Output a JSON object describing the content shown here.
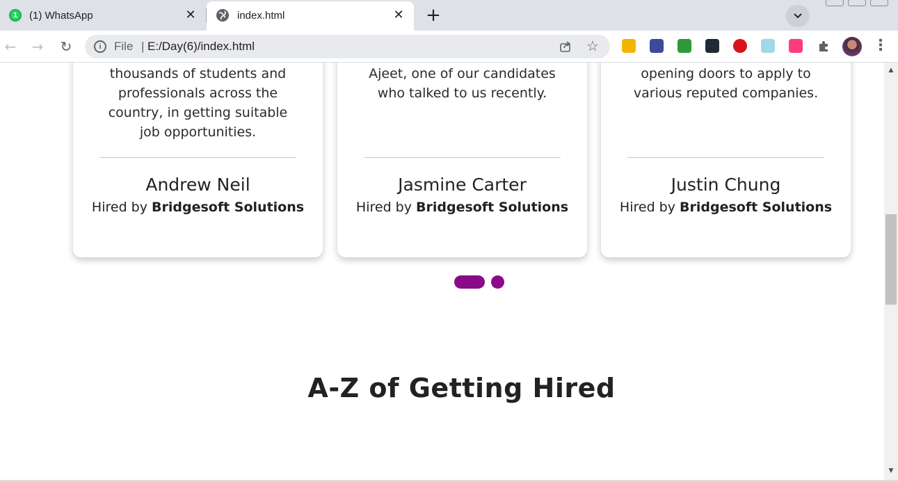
{
  "browser": {
    "tabs": [
      {
        "title": "(1) WhatsApp",
        "favicon": "whatsapp-icon",
        "badge": "1",
        "active": false
      },
      {
        "title": "index.html",
        "favicon": "globe-icon",
        "active": true
      }
    ],
    "close_glyph": "✕",
    "new_tab_glyph": "+",
    "tab_search_glyph": "⌄",
    "nav": {
      "back": "←",
      "forward": "→",
      "reload": "↻"
    },
    "omnibox": {
      "info_glyph": "i",
      "scheme": "File",
      "separator": "|",
      "url": "E:/Day(6)/index.html"
    },
    "star_glyph": "☆",
    "menu_glyph": "⋮",
    "extensions": [
      {
        "name": "ext-folder-icon",
        "color": "#f4b400"
      },
      {
        "name": "ext-screen-icon",
        "color": "#3c4a9e"
      },
      {
        "name": "ext-tomato-icon",
        "color": "#2e9a3a"
      },
      {
        "name": "ext-terminal-icon",
        "color": "#1f2a36"
      },
      {
        "name": "ext-ask-icon",
        "color": "#d7141a"
      },
      {
        "name": "ext-clip-icon",
        "color": "#9fd8e6"
      },
      {
        "name": "ext-music-icon",
        "color": "#ff3b7f"
      },
      {
        "name": "extensions-puzzle-icon",
        "color": "#5f6368"
      }
    ]
  },
  "testimonials": [
    {
      "quote_lines": [
        "thousands of students and",
        "professionals across the",
        "country, in getting suitable",
        "job opportunities."
      ],
      "name": "Andrew Neil",
      "hired_prefix": "Hired by ",
      "company": "Bridgesoft Solutions"
    },
    {
      "quote_lines": [
        "Ajeet, one of our candidates",
        "who talked to us recently."
      ],
      "name": "Jasmine Carter",
      "hired_prefix": "Hired by ",
      "company": "Bridgesoft Solutions"
    },
    {
      "quote_lines": [
        "opening doors to apply to",
        "various reputed companies."
      ],
      "name": "Justin Chung",
      "hired_prefix": "Hired by ",
      "company": "Bridgesoft Solutions"
    }
  ],
  "carousel": {
    "accent": "#8a0a8a",
    "active_index": 0,
    "count": 2
  },
  "section": {
    "heading": "A-Z of Getting Hired"
  },
  "scrollbar": {
    "up_glyph": "▲",
    "down_glyph": "▼",
    "position_fraction": 0.46
  }
}
